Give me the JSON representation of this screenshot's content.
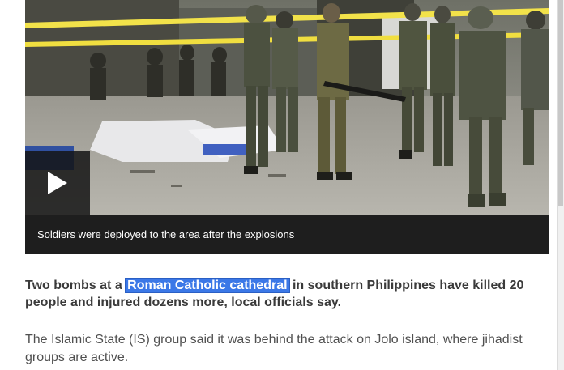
{
  "media": {
    "caption": "Soldiers were deployed to the area after the explosions",
    "play_icon": "play-icon"
  },
  "article": {
    "lead_before": "Two bombs at a ",
    "lead_highlight": "Roman Catholic cathedral",
    "lead_after": " in southern Philippines have killed 20 people and injured dozens more, local officials say.",
    "highlight_color": "#3b78e7",
    "paragraph": "The Islamic State (IS) group said it was behind the attack on Jolo island, where jihadist groups are active."
  }
}
